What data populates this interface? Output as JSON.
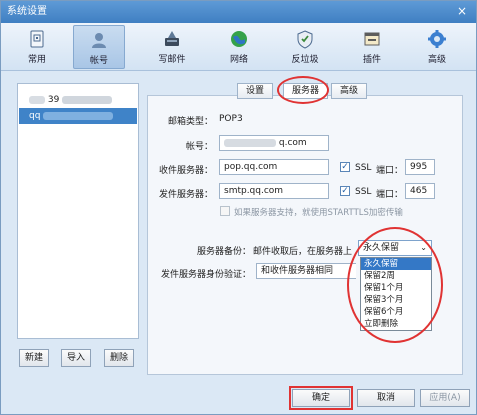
{
  "window": {
    "title": "系统设置",
    "close": "×"
  },
  "toolbar": {
    "items": [
      {
        "label": "常用",
        "icon": "general-settings-icon"
      },
      {
        "label": "帐号",
        "icon": "account-icon"
      },
      {
        "label": "写邮件",
        "icon": "compose-icon"
      },
      {
        "label": "网络",
        "icon": "network-icon"
      },
      {
        "label": "反垃圾",
        "icon": "antispam-shield-icon"
      },
      {
        "label": "插件",
        "icon": "plugin-icon"
      },
      {
        "label": "高级",
        "icon": "advanced-gear-icon"
      }
    ],
    "active_index": 1
  },
  "accounts": {
    "items": [
      {
        "text": "39"
      },
      {
        "text": "qq"
      }
    ],
    "selected": 1
  },
  "left_buttons": {
    "new": "新建",
    "import": "导入",
    "delete": "删除"
  },
  "tabs": {
    "items": [
      "设置",
      "服务器",
      "高级"
    ],
    "active": "服务器"
  },
  "server": {
    "mailbox_type_label": "邮箱类型：",
    "mailbox_type": "POP3",
    "account_label": "帐号：",
    "account_value": "q.com",
    "incoming_label": "收件服务器：",
    "incoming_value": "pop.qq.com",
    "incoming_ssl_label": "SSL",
    "incoming_port_label": "端口：",
    "incoming_port": "995",
    "outgoing_label": "发件服务器：",
    "outgoing_value": "smtp.qq.com",
    "outgoing_ssl_label": "SSL",
    "outgoing_port_label": "端口：",
    "outgoing_port": "465",
    "starttls_note": "如果服务器支持，就使用STARTTLS加密传输",
    "backup_label": "服务器备份：",
    "backup_desc": "邮件收取后，在服务器上",
    "backup_selected": "永久保留",
    "backup_options": [
      "永久保留",
      "保留2周",
      "保留1个月",
      "保留3个月",
      "保留6个月",
      "立即删除"
    ],
    "auth_label": "发件服务器身份验证：",
    "auth_value": "和收件服务器相同"
  },
  "bottom_buttons": {
    "ok": "确定",
    "cancel": "取消",
    "apply": "应用(A)"
  },
  "colors": {
    "accent": "#3f83c8",
    "annotation": "#e03333",
    "titlebar": "#4a88c9"
  }
}
